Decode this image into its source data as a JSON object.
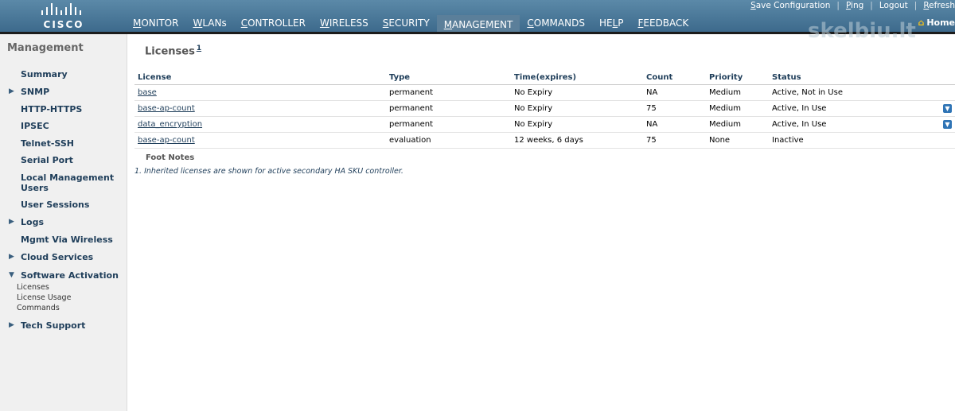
{
  "brand": {
    "name": "CISCO"
  },
  "nav": [
    {
      "label": "MONITOR",
      "active": false
    },
    {
      "label": "WLANs",
      "active": false
    },
    {
      "label": "CONTROLLER",
      "active": false
    },
    {
      "label": "WIRELESS",
      "active": false
    },
    {
      "label": "SECURITY",
      "active": false
    },
    {
      "label": "MANAGEMENT",
      "active": true
    },
    {
      "label": "COMMANDS",
      "active": false
    },
    {
      "label": "HELP",
      "active": false
    },
    {
      "label": "FEEDBACK",
      "active": false
    }
  ],
  "toplinks": {
    "save": "Save Configuration",
    "ping": "Ping",
    "logout": "Logout",
    "refresh": "Refresh"
  },
  "home_label": "Home",
  "sidebar": {
    "title": "Management",
    "items": [
      {
        "label": "Summary",
        "expandable": false
      },
      {
        "label": "SNMP",
        "expandable": true
      },
      {
        "label": "HTTP-HTTPS",
        "expandable": false
      },
      {
        "label": "IPSEC",
        "expandable": false
      },
      {
        "label": "Telnet-SSH",
        "expandable": false
      },
      {
        "label": "Serial Port",
        "expandable": false
      },
      {
        "label": "Local Management Users",
        "expandable": false
      },
      {
        "label": "User Sessions",
        "expandable": false
      },
      {
        "label": "Logs",
        "expandable": true
      },
      {
        "label": "Mgmt Via Wireless",
        "expandable": false
      },
      {
        "label": "Cloud Services",
        "expandable": true
      },
      {
        "label": "Software Activation",
        "expandable": true,
        "expanded": true
      },
      {
        "label": "Tech Support",
        "expandable": true
      }
    ],
    "software_activation_sub": [
      "Licenses",
      "License Usage",
      "Commands"
    ]
  },
  "main": {
    "title": "Licenses",
    "title_sup": "1",
    "columns": [
      "License",
      "Type",
      "Time(expires)",
      "Count",
      "Priority",
      "Status"
    ],
    "rows": [
      {
        "license": "base",
        "type": "permanent",
        "time": "No Expiry",
        "count": "NA",
        "priority": "Medium",
        "status": "Active, Not in Use",
        "dropdown": false
      },
      {
        "license": "base-ap-count",
        "type": "permanent",
        "time": "No Expiry",
        "count": "75",
        "priority": "Medium",
        "status": "Active, In Use",
        "dropdown": true
      },
      {
        "license": "data_encryption",
        "type": "permanent",
        "time": "No Expiry",
        "count": "NA",
        "priority": "Medium",
        "status": "Active, In Use",
        "dropdown": true
      },
      {
        "license": "base-ap-count",
        "type": "evaluation",
        "time": "12 weeks, 6 days",
        "count": "75",
        "priority": "None",
        "status": "Inactive",
        "dropdown": false
      }
    ],
    "footnotes_title": "Foot Notes",
    "footnote_1": "1. Inherited licenses are shown for active secondary HA SKU controller."
  },
  "watermark": "skelbiu.lt"
}
